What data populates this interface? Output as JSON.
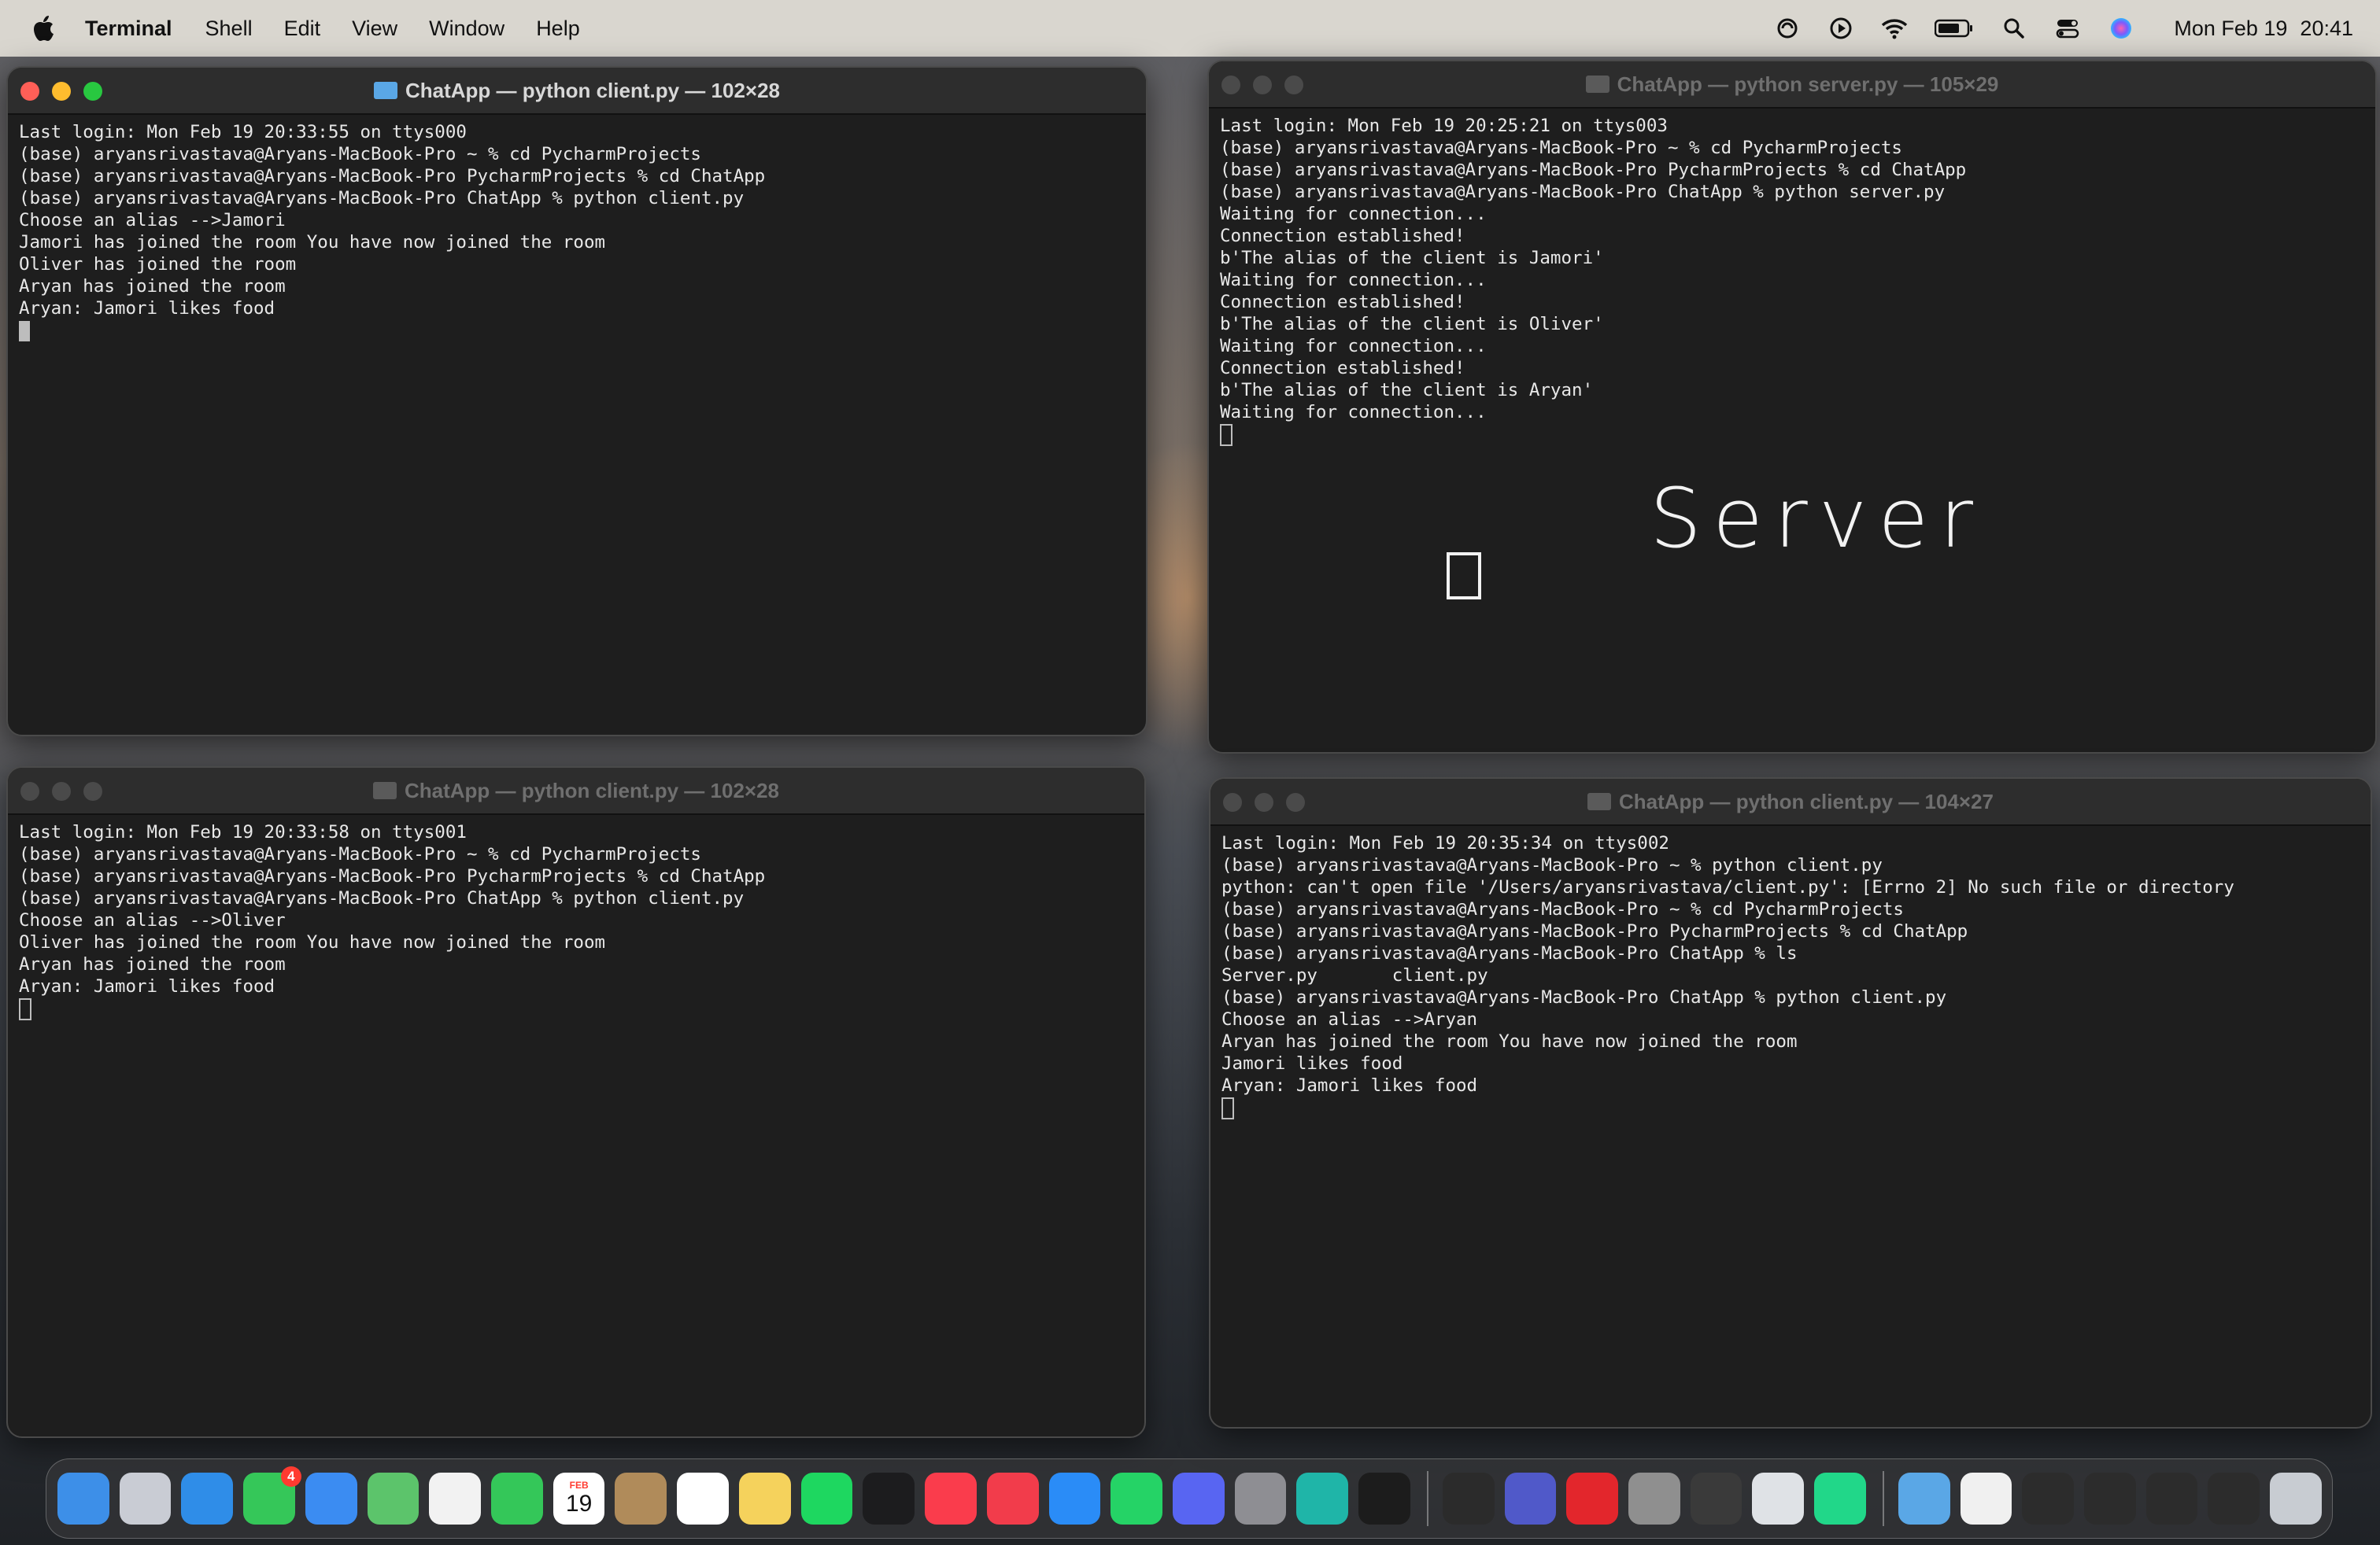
{
  "menubar": {
    "app_name": "Terminal",
    "items": [
      "Shell",
      "Edit",
      "View",
      "Window",
      "Help"
    ],
    "date": "Mon Feb 19",
    "time": "20:41"
  },
  "windows": {
    "tl": {
      "title": "ChatApp — python client.py — 102×28",
      "lines": [
        "Last login: Mon Feb 19 20:33:55 on ttys000",
        "(base) aryansrivastava@Aryans-MacBook-Pro ~ % cd PycharmProjects",
        "(base) aryansrivastava@Aryans-MacBook-Pro PycharmProjects % cd ChatApp",
        "(base) aryansrivastava@Aryans-MacBook-Pro ChatApp % python client.py",
        "Choose an alias -->Jamori",
        "Jamori has joined the room You have now joined the room",
        "Oliver has joined the room",
        "Aryan has joined the room",
        "Aryan: Jamori likes food"
      ]
    },
    "tr": {
      "title": "ChatApp — python server.py — 105×29",
      "lines": [
        "Last login: Mon Feb 19 20:25:21 on ttys003",
        "(base) aryansrivastava@Aryans-MacBook-Pro ~ % cd PycharmProjects",
        "(base) aryansrivastava@Aryans-MacBook-Pro PycharmProjects % cd ChatApp",
        "(base) aryansrivastava@Aryans-MacBook-Pro ChatApp % python server.py",
        "Waiting for connection...",
        "Connection established!",
        "b'The alias of the client is Jamori'",
        "Waiting for connection...",
        "Connection established!",
        "b'The alias of the client is Oliver'",
        "Waiting for connection...",
        "Connection established!",
        "b'The alias of the client is Aryan'",
        "Waiting for connection..."
      ],
      "annotation": "Server"
    },
    "bl": {
      "title": "ChatApp — python client.py — 102×28",
      "lines": [
        "Last login: Mon Feb 19 20:33:58 on ttys001",
        "(base) aryansrivastava@Aryans-MacBook-Pro ~ % cd PycharmProjects",
        "(base) aryansrivastava@Aryans-MacBook-Pro PycharmProjects % cd ChatApp",
        "(base) aryansrivastava@Aryans-MacBook-Pro ChatApp % python client.py",
        "Choose an alias -->Oliver",
        "Oliver has joined the room You have now joined the room",
        "Aryan has joined the room",
        "Aryan: Jamori likes food"
      ]
    },
    "br": {
      "title": "ChatApp — python client.py — 104×27",
      "lines": [
        "Last login: Mon Feb 19 20:35:34 on ttys002",
        "(base) aryansrivastava@Aryans-MacBook-Pro ~ % python client.py",
        "python: can't open file '/Users/aryansrivastava/client.py': [Errno 2] No such file or directory",
        "(base) aryansrivastava@Aryans-MacBook-Pro ~ % cd PycharmProjects",
        "(base) aryansrivastava@Aryans-MacBook-Pro PycharmProjects % cd ChatApp",
        "(base) aryansrivastava@Aryans-MacBook-Pro ChatApp % ls",
        "Server.py       client.py",
        "(base) aryansrivastava@Aryans-MacBook-Pro ChatApp % python client.py",
        "Choose an alias -->Aryan",
        "Aryan has joined the room You have now joined the room",
        "Jamori likes food",
        "Aryan: Jamori likes food"
      ]
    }
  },
  "dock": {
    "messages_badge": "4",
    "calendar": {
      "month": "FEB",
      "day": "19"
    },
    "apps": [
      {
        "name": "finder-icon",
        "color": "#3d8fe8"
      },
      {
        "name": "launchpad-icon",
        "color": "#c9ccd4"
      },
      {
        "name": "safari-icon",
        "color": "#2f8de8"
      },
      {
        "name": "messages-icon",
        "color": "#35c759"
      },
      {
        "name": "mail-icon",
        "color": "#3b8cf2"
      },
      {
        "name": "maps-icon",
        "color": "#5cc46b"
      },
      {
        "name": "photos-icon",
        "color": "#f2f2f2"
      },
      {
        "name": "facetime-icon",
        "color": "#34c759"
      },
      {
        "name": "calendar-icon",
        "color": "#ffffff"
      },
      {
        "name": "contacts-icon",
        "color": "#b08b5a"
      },
      {
        "name": "reminders-icon",
        "color": "#ffffff"
      },
      {
        "name": "notes-icon",
        "color": "#f5d25c"
      },
      {
        "name": "spotify-icon",
        "color": "#1ed760"
      },
      {
        "name": "appletv-icon",
        "color": "#1c1c1e"
      },
      {
        "name": "music-icon",
        "color": "#fa3c4c"
      },
      {
        "name": "news-icon",
        "color": "#f23c4b"
      },
      {
        "name": "appstore-icon",
        "color": "#2a8cf7"
      },
      {
        "name": "whatsapp-icon",
        "color": "#25d366"
      },
      {
        "name": "discord-icon",
        "color": "#5865f2"
      },
      {
        "name": "system-settings-icon",
        "color": "#8e8e93"
      },
      {
        "name": "surfshark-icon",
        "color": "#1fb5a8"
      },
      {
        "name": "intellij-icon",
        "color": "#1c1c1c"
      }
    ],
    "apps2": [
      {
        "name": "terminal-icon",
        "color": "#2b2b2b"
      },
      {
        "name": "teams-icon",
        "color": "#5059c9"
      },
      {
        "name": "acrobat-icon",
        "color": "#e3262c"
      },
      {
        "name": "font-book-icon",
        "color": "#8f8f8f"
      },
      {
        "name": "activity-monitor-icon",
        "color": "#3a3a3a"
      },
      {
        "name": "disk-utility-icon",
        "color": "#dfe2e6"
      },
      {
        "name": "pycharm-icon",
        "color": "#21d789"
      }
    ],
    "apps3": [
      {
        "name": "downloads-folder-icon",
        "color": "#5aa7e6"
      },
      {
        "name": "document-icon",
        "color": "#f0f0f0"
      },
      {
        "name": "window-thumbnail-icon",
        "color": "#2c2c2c"
      },
      {
        "name": "window-thumbnail-icon",
        "color": "#2c2c2c"
      },
      {
        "name": "window-thumbnail-icon",
        "color": "#2c2c2c"
      },
      {
        "name": "window-thumbnail-icon",
        "color": "#2c2c2c"
      },
      {
        "name": "trash-icon",
        "color": "#c8ccd2"
      }
    ]
  }
}
